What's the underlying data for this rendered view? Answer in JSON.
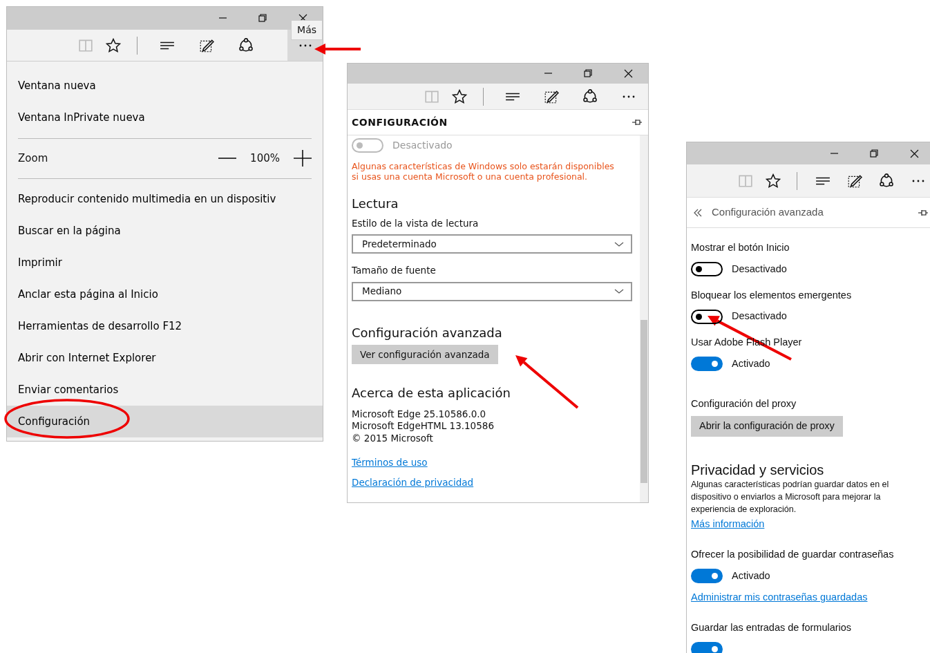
{
  "menu_window": {
    "tooltip": "Más",
    "items": [
      {
        "kind": "item",
        "label": "Ventana nueva",
        "selected": false
      },
      {
        "kind": "item",
        "label": "Ventana InPrivate nueva",
        "selected": false
      },
      {
        "kind": "separator"
      },
      {
        "kind": "zoom",
        "label": "Zoom",
        "value": "100%"
      },
      {
        "kind": "separator"
      },
      {
        "kind": "item",
        "label": "Reproducir contenido multimedia en un dispositiv",
        "selected": false
      },
      {
        "kind": "item",
        "label": "Buscar en la página",
        "selected": false
      },
      {
        "kind": "item",
        "label": "Imprimir",
        "selected": false
      },
      {
        "kind": "item",
        "label": "Anclar esta página al Inicio",
        "selected": false
      },
      {
        "kind": "item",
        "label": "Herramientas de desarrollo F12",
        "selected": false
      },
      {
        "kind": "item",
        "label": "Abrir con Internet Explorer",
        "selected": false
      },
      {
        "kind": "item",
        "label": "Enviar comentarios",
        "selected": false
      },
      {
        "kind": "item",
        "label": "Configuración",
        "selected": true
      }
    ]
  },
  "settings_window": {
    "title": "CONFIGURACIÓN",
    "content": [
      {
        "kind": "toggle",
        "on": false,
        "disabled": true,
        "label": "Desactivado"
      },
      {
        "kind": "warning",
        "text": "Algunas características de Windows solo estarán disponibles si usas una cuenta Microsoft o una cuenta profesional."
      },
      {
        "kind": "heading",
        "text": "Lectura"
      },
      {
        "kind": "label",
        "text": "Estilo de la vista de lectura"
      },
      {
        "kind": "select",
        "value": "Predeterminado"
      },
      {
        "kind": "label",
        "text": "Tamaño de fuente"
      },
      {
        "kind": "select",
        "value": "Mediano"
      },
      {
        "kind": "heading",
        "text": "Configuración avanzada"
      },
      {
        "kind": "button",
        "text": "Ver configuración avanzada"
      },
      {
        "kind": "heading",
        "text": "Acerca de esta aplicación"
      },
      {
        "kind": "text",
        "text": "Microsoft Edge 25.10586.0.0"
      },
      {
        "kind": "text",
        "text": "Microsoft EdgeHTML 13.10586"
      },
      {
        "kind": "text",
        "text": "© 2015 Microsoft"
      },
      {
        "kind": "link",
        "text": "Términos de uso"
      },
      {
        "kind": "link",
        "text": "Declaración de privacidad"
      }
    ]
  },
  "advanced_window": {
    "title": "Configuración avanzada",
    "content": [
      {
        "kind": "label",
        "text": "Mostrar el botón Inicio"
      },
      {
        "kind": "toggle",
        "on": false,
        "disabled": false,
        "label": "Desactivado"
      },
      {
        "kind": "label",
        "text": "Bloquear los elementos emergentes"
      },
      {
        "kind": "toggle",
        "on": false,
        "disabled": false,
        "label": "Desactivado"
      },
      {
        "kind": "label",
        "text": "Usar Adobe Flash Player"
      },
      {
        "kind": "toggle",
        "on": true,
        "disabled": false,
        "label": "Activado"
      },
      {
        "kind": "label",
        "text": "Configuración del proxy"
      },
      {
        "kind": "button",
        "text": "Abrir la configuración de proxy"
      },
      {
        "kind": "heading",
        "text": "Privacidad y servicios"
      },
      {
        "kind": "note",
        "text": "Algunas características podrían guardar datos en el dispositivo o enviarlos a Microsoft para mejorar la experiencia de exploración."
      },
      {
        "kind": "link",
        "text": "Más información"
      },
      {
        "kind": "label",
        "text": "Ofrecer la posibilidad de guardar contraseñas"
      },
      {
        "kind": "toggle",
        "on": true,
        "disabled": false,
        "label": "Activado"
      },
      {
        "kind": "link",
        "text": "Administrar mis contraseñas guardadas"
      },
      {
        "kind": "label",
        "text": "Guardar las entradas de formularios"
      },
      {
        "kind": "toggle",
        "on": true,
        "disabled": false
      }
    ]
  }
}
